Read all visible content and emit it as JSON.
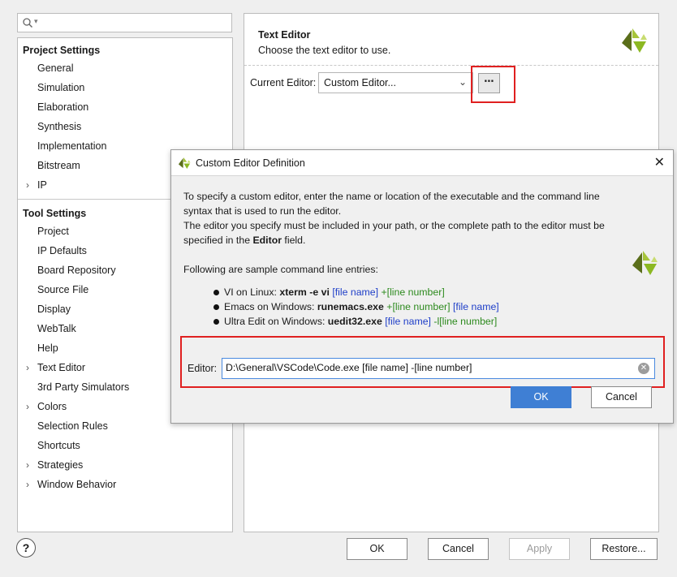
{
  "search": {
    "placeholder": ""
  },
  "tree": {
    "project_settings": {
      "title": "Project Settings",
      "items": [
        "General",
        "Simulation",
        "Elaboration",
        "Synthesis",
        "Implementation",
        "Bitstream",
        "IP"
      ]
    },
    "tool_settings": {
      "title": "Tool Settings",
      "items": [
        "Project",
        "IP Defaults",
        "Board Repository",
        "Source File",
        "Display",
        "WebTalk",
        "Help",
        "Text Editor",
        "3rd Party Simulators",
        "Colors",
        "Selection Rules",
        "Shortcuts",
        "Strategies",
        "Window Behavior"
      ]
    }
  },
  "panel": {
    "title": "Text Editor",
    "subtitle": "Choose the text editor to use.",
    "current_editor_label": "Current Editor:",
    "current_editor_value": "Custom Editor...",
    "dots_label": "⋯"
  },
  "dialog": {
    "title": "Custom Editor Definition",
    "lines": [
      "To specify a custom editor, enter the name or location of the executable and the command line",
      "syntax that is used to run the editor.",
      "The editor you specify must be included in your path, or the complete path to the editor must be",
      "specified in the",
      "Editor",
      "field."
    ],
    "sample_heading": "Following are sample command line entries:",
    "samples": [
      {
        "prefix": "VI on Linux: ",
        "cmd": "xterm -e vi",
        "a": "[file name]",
        "b": "+[line number]"
      },
      {
        "prefix": "Emacs on Windows: ",
        "cmd": "runemacs.exe",
        "a": "+[line number]",
        "b": "[file name]"
      },
      {
        "prefix": "Ultra Edit on Windows: ",
        "cmd": "uedit32.exe",
        "a": "[file name]",
        "b": "-l[line number]"
      }
    ],
    "editor_label": "Editor:",
    "editor_value": "D:\\General\\VSCode\\Code.exe [file name] -[line number]",
    "ok": "OK",
    "cancel": "Cancel"
  },
  "bottom": {
    "help": "?",
    "ok": "OK",
    "cancel": "Cancel",
    "apply": "Apply",
    "restore": "Restore..."
  },
  "colors": {
    "accent": "#3f7fd4",
    "highlight": "#e02020",
    "logo_green": "#8cb822",
    "logo_dark": "#5a6e1a"
  }
}
